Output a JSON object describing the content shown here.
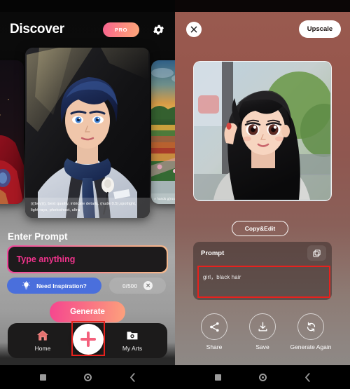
{
  "left": {
    "header": {
      "title": "Discover",
      "pro_label": "PRO",
      "settings_icon": "gear-icon"
    },
    "carousel": {
      "main_card": {
        "caption": "(((boy))), best quality, intricate details, (nude:0.5),spotlight, light rays, photoshoot, ultra",
        "alt": "anime boy with navy blue hair in light gray suit and navy scarf"
      },
      "left_card": {
        "alt": "dark crimson fantasy character artwork"
      },
      "right_card": {
        "caption": "A hands g(round",
        "alt": "colorful sunset landscape with fields and flowers"
      }
    },
    "prompt_section": {
      "label": "Enter Prompt",
      "input_value": "",
      "input_placeholder": "Type anything",
      "inspiration_label": "Need Inspiration?",
      "inspiration_icon": "lightbulb-icon",
      "char_count": "0/500",
      "clear_icon": "close-x-icon"
    },
    "generate_label": "Generate",
    "tabbar": {
      "items": [
        {
          "label": "Home",
          "icon": "home-icon"
        },
        {
          "label": "My Arts",
          "icon": "folder-camera-icon"
        }
      ],
      "fab_icon": "plus-icon"
    },
    "navbar": {
      "recents_icon": "square-recents-icon",
      "home_icon": "circle-home-icon",
      "back_icon": "chevron-back-icon"
    }
  },
  "right": {
    "close_icon": "close-x-icon",
    "upscale_label": "Upscale",
    "result_image": {
      "alt": "anime girl with long black hair touching her hair outdoors"
    },
    "copy_edit_label": "Copy&Edit",
    "prompt_card": {
      "title": "Prompt",
      "copy_icon": "copy-icon",
      "text": "girl，black hair"
    },
    "actions": [
      {
        "label": "Share",
        "icon": "share-icon"
      },
      {
        "label": "Save",
        "icon": "download-icon"
      },
      {
        "label": "Generate Again",
        "icon": "refresh-icon"
      }
    ],
    "navbar": {
      "recents_icon": "square-recents-icon",
      "home_icon": "circle-home-icon",
      "back_icon": "chevron-back-icon"
    }
  },
  "colors": {
    "accent_pink": "#f3338d",
    "accent_peach": "#fca17c",
    "inspiration_blue": "#4a6fdc",
    "highlight_red": "#e8211d",
    "right_panel_bg": "#9a5b50"
  }
}
